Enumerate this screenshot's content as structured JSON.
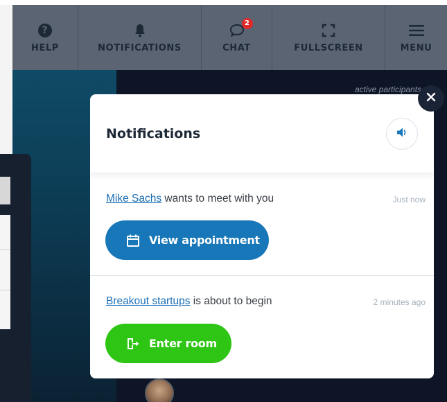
{
  "topbar": {
    "items": [
      {
        "label": "HELP",
        "icon": "question-circle-icon"
      },
      {
        "label": "NOTIFICATIONS",
        "icon": "bell-icon"
      },
      {
        "label": "CHAT",
        "icon": "chat-bubble-icon",
        "badge": "2"
      },
      {
        "label": "FULLSCREEN",
        "icon": "fullscreen-icon"
      },
      {
        "label": "MENU",
        "icon": "hamburger-icon"
      }
    ]
  },
  "background": {
    "participants_text": "active participants"
  },
  "modal": {
    "title": "Notifications",
    "sound_icon": "speaker-icon",
    "close_icon": "close-icon",
    "notifications": [
      {
        "link_text": "Mike Sachs",
        "text": " wants to meet with you",
        "time": "Just now",
        "button_label": "View appointment",
        "button_icon": "calendar-icon"
      },
      {
        "link_text": "Breakout startups",
        "text": " is about to begin",
        "time": "2 minutes ago",
        "button_label": "Enter room",
        "button_icon": "enter-door-icon"
      }
    ]
  },
  "colors": {
    "topbar_bg": "#5b6472",
    "primary_blue": "#1777b8",
    "success_green": "#2ec514",
    "link_blue": "#1b6fb5",
    "badge_red": "#e02a2a"
  }
}
